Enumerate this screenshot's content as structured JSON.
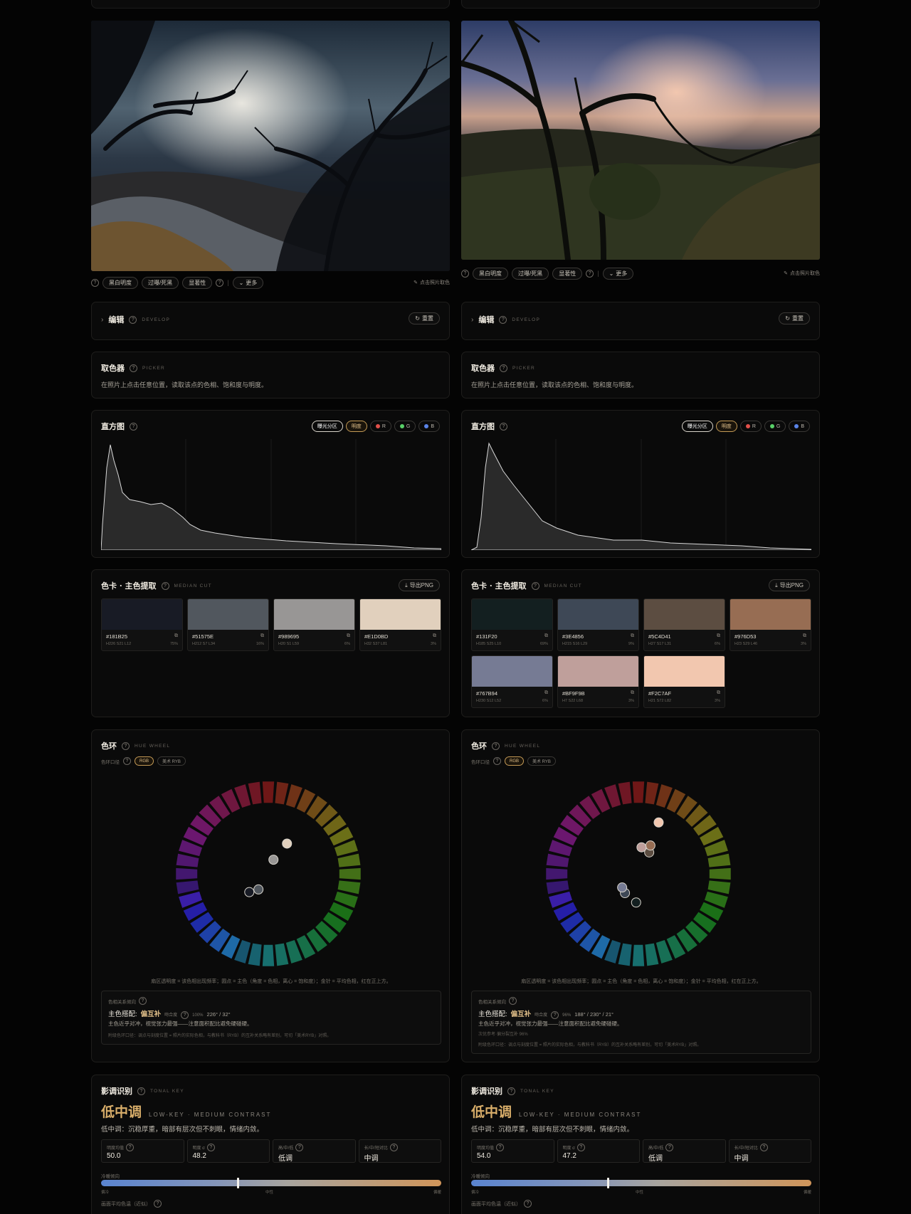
{
  "toolbar": {
    "chips": [
      "黑白明度",
      "过曝/死黑",
      "显著性"
    ],
    "more": "更多",
    "pick_hint": "点击照片取色"
  },
  "develop": {
    "title": "编辑",
    "subtitle": "DEVELOP",
    "reset": "重置"
  },
  "picker": {
    "title": "取色器",
    "subtitle": "PICKER",
    "desc": "在照片上点击任意位置，读取该点的色相、饱和度与明度。"
  },
  "histogram": {
    "title": "直方图",
    "tabs": [
      "曝光分区",
      "明度",
      "R",
      "G",
      "B"
    ],
    "dot_colors": {
      "R": "#e0504a",
      "G": "#58d068",
      "B": "#5a84e8"
    }
  },
  "palette": {
    "title": "色卡 · 主色提取",
    "subtitle": "MEDIAN CUT",
    "export": "导出PNG"
  },
  "huewheel": {
    "title": "色环",
    "subtitle": "HUE WHEEL",
    "mode_label": "色环口径",
    "modes": [
      "RGB",
      "美术 RYB"
    ],
    "caption": "扇区透明度 = 该色相出现频率；圆点 = 主色（角度 = 色相，离心 = 饱和度）；金针 = 平均色相，红在正上方。",
    "rel_label": "色相关系倾向",
    "match_label": "主色搭配:",
    "match_value": "偏互补",
    "fit_label": "吻合度"
  },
  "tonal": {
    "title": "影调识别",
    "subtitle": "TONAL KEY",
    "key_zh": "低中调",
    "key_en": "LOW-KEY · MEDIUM CONTRAST",
    "desc": "低中调：沉稳厚重，暗部有层次但不刺眼，情绪内敛。",
    "stat_labels": [
      "明度均值",
      "明度 σ",
      "高/中/低",
      "长/中/短对比"
    ],
    "temp_label": "冷暖倾向",
    "temp_ticks": [
      "偏冷",
      "中性",
      "偏暖"
    ],
    "avg_label": "画面平均色温（近似）"
  },
  "panels": [
    {
      "fit": "100%",
      "angles": "226° / 32°",
      "rel_desc": "主色近乎对冲，视觉张力最强——注意面积配比避免硬碰硬。",
      "rel_extra": "",
      "rel_note": "附级色环口径：调点与刻度位置 = 照片的实际色相，与教科书（RYB）的互补关系略有差别，可切「美术RYB」对照。",
      "swatches": [
        {
          "hex": "#181B25",
          "hsl": "H226 S21 L12",
          "pct": "75%"
        },
        {
          "hex": "#51575E",
          "hsl": "H212 S7 L34",
          "pct": "16%"
        },
        {
          "hex": "#989695",
          "hsl": "H20 S1 L59",
          "pct": "6%"
        },
        {
          "hex": "#E1D0BD",
          "hsl": "H32 S37 L81",
          "pct": "3%"
        }
      ],
      "stats": [
        "50.0",
        "48.2",
        "低调",
        "中调"
      ],
      "temp_pos": 0.4
    },
    {
      "fit": "96%",
      "angles": "188° / 230° / 21°",
      "rel_desc": "主色近乎对冲，视觉张力最强——注意面积配比避免硬碰硬。",
      "rel_extra": "次优参考·偏分裂互补 96%",
      "rel_note": "附级色环口径：调点与刻度位置 = 照片的实际色相，与教科书（RYB）的互补关系略有差别，可切「美术RYB」对照。",
      "swatches": [
        {
          "hex": "#131F20",
          "hsl": "H185 S25 L10",
          "pct": "69%"
        },
        {
          "hex": "#3E4856",
          "hsl": "H215 S16 L29",
          "pct": "9%"
        },
        {
          "hex": "#5C4D41",
          "hsl": "H27 S17 L31",
          "pct": "6%"
        },
        {
          "hex": "#976D53",
          "hsl": "H23 S29 L46",
          "pct": "3%"
        },
        {
          "hex": "#767B94",
          "hsl": "H230 S12 L52",
          "pct": "6%"
        },
        {
          "hex": "#BF9F9B",
          "hsl": "H7 S22 L68",
          "pct": "3%"
        },
        {
          "hex": "#F2C7AF",
          "hsl": "H21 S72 L82",
          "pct": "3%"
        }
      ],
      "stats": [
        "54.0",
        "47.2",
        "低调",
        "中调"
      ],
      "temp_pos": 0.4
    }
  ]
}
